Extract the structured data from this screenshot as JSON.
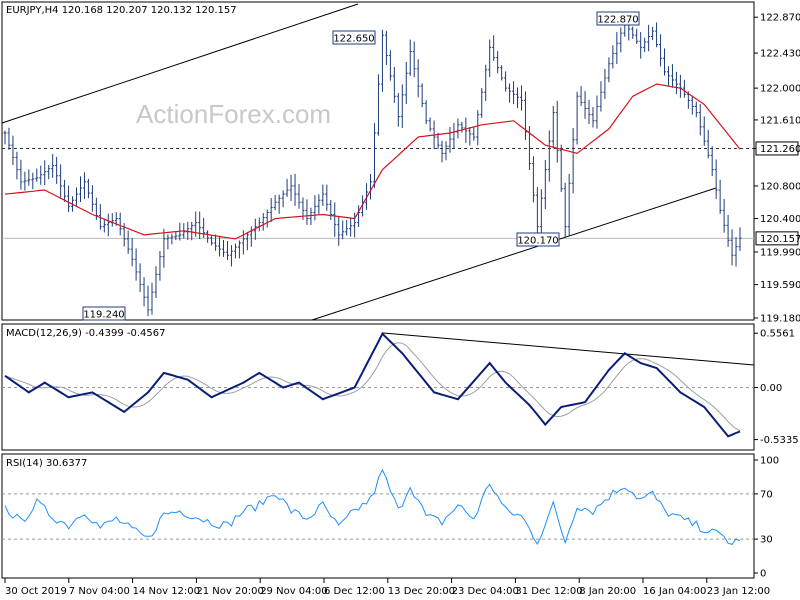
{
  "header": {
    "main": "EURJPY,H4  120.168 120.207 120.132 120.157",
    "macd": "MACD(12,26,9) -0.4399 -0.4567",
    "rsi": "RSI(14) 30.6377"
  },
  "watermark": "ActionForex.com",
  "colors": {
    "price": "#1e3c78",
    "ma": "#d2141e",
    "macd": "#0a1e78",
    "signal": "#9aa0a8",
    "rsi": "#1e90ff",
    "trend": "#000000",
    "frame": "#000000"
  },
  "chart_data": [
    {
      "type": "candlestick",
      "symbol": "EURJPY",
      "timeframe": "H4",
      "ylim": [
        119.18,
        123.02
      ],
      "yticks": [
        "122.870",
        "122.430",
        "122.000",
        "121.610",
        "121.260",
        "120.800",
        "120.400",
        "119.990",
        "119.590",
        "119.180"
      ],
      "current_price": "120.157",
      "hlines": [
        {
          "value": 121.26,
          "style": "dashed",
          "label": "121.260"
        },
        {
          "value": 120.157,
          "style": "solid",
          "label": "120.157"
        }
      ],
      "annotations": [
        {
          "label": "122.650",
          "value": 122.65
        },
        {
          "label": "122.870",
          "value": 122.87
        },
        {
          "label": "120.170",
          "value": 120.17
        },
        {
          "label": "119.240",
          "value": 119.24
        }
      ],
      "anchors": [
        [
          0,
          121.45
        ],
        [
          4,
          120.85
        ],
        [
          8,
          120.9
        ],
        [
          12,
          121.05
        ],
        [
          16,
          120.55
        ],
        [
          20,
          120.85
        ],
        [
          24,
          120.3
        ],
        [
          28,
          120.4
        ],
        [
          32,
          119.9
        ],
        [
          36,
          119.28
        ],
        [
          40,
          120.15
        ],
        [
          44,
          120.2
        ],
        [
          48,
          120.35
        ],
        [
          52,
          120.1
        ],
        [
          56,
          119.95
        ],
        [
          60,
          120.15
        ],
        [
          64,
          120.35
        ],
        [
          68,
          120.6
        ],
        [
          72,
          120.8
        ],
        [
          76,
          120.4
        ],
        [
          80,
          120.7
        ],
        [
          84,
          120.2
        ],
        [
          88,
          120.35
        ],
        [
          92,
          120.85
        ],
        [
          95,
          122.65
        ],
        [
          99,
          121.65
        ],
        [
          102,
          122.45
        ],
        [
          106,
          121.6
        ],
        [
          110,
          121.2
        ],
        [
          114,
          121.55
        ],
        [
          118,
          121.4
        ],
        [
          122,
          122.5
        ],
        [
          126,
          122.0
        ],
        [
          130,
          121.85
        ],
        [
          134,
          120.3
        ],
        [
          138,
          121.7
        ],
        [
          141,
          120.3
        ],
        [
          144,
          121.9
        ],
        [
          148,
          121.6
        ],
        [
          152,
          122.3
        ],
        [
          156,
          122.8
        ],
        [
          160,
          122.5
        ],
        [
          163,
          122.7
        ],
        [
          166,
          122.2
        ],
        [
          170,
          122.0
        ],
        [
          174,
          121.7
        ],
        [
          178,
          121.0
        ],
        [
          180,
          120.5
        ],
        [
          183,
          119.95
        ],
        [
          185,
          120.16
        ]
      ],
      "ma_anchors": [
        [
          0,
          120.7
        ],
        [
          10,
          120.75
        ],
        [
          22,
          120.45
        ],
        [
          35,
          120.2
        ],
        [
          45,
          120.25
        ],
        [
          58,
          120.15
        ],
        [
          68,
          120.4
        ],
        [
          80,
          120.45
        ],
        [
          88,
          120.4
        ],
        [
          95,
          121.0
        ],
        [
          104,
          121.4
        ],
        [
          112,
          121.45
        ],
        [
          120,
          121.55
        ],
        [
          128,
          121.6
        ],
        [
          136,
          121.3
        ],
        [
          144,
          121.2
        ],
        [
          152,
          121.5
        ],
        [
          158,
          121.9
        ],
        [
          164,
          122.05
        ],
        [
          170,
          122.0
        ],
        [
          176,
          121.8
        ],
        [
          185,
          121.25
        ]
      ],
      "x_labels": [
        "30 Oct 2019",
        "7 Nov 04:00",
        "14 Nov 12:00",
        "21 Nov 20:00",
        "29 Nov 04:00",
        "6 Dec 12:00",
        "13 Dec 20:00",
        "23 Dec 04:00",
        "31 Dec 12:00",
        "8 Jan 20:00",
        "16 Jan 04:00",
        "23 Jan 12:00"
      ]
    },
    {
      "type": "line",
      "name": "MACD(12,26,9)",
      "ylim": [
        -0.62,
        0.62
      ],
      "yticks": [
        "0.5561",
        "0.00",
        "-0.5335"
      ],
      "values_label": "-0.4399 -0.4567",
      "anchors": [
        [
          0,
          0.12
        ],
        [
          6,
          -0.05
        ],
        [
          10,
          0.05
        ],
        [
          16,
          -0.1
        ],
        [
          22,
          -0.05
        ],
        [
          30,
          -0.25
        ],
        [
          36,
          -0.05
        ],
        [
          40,
          0.15
        ],
        [
          46,
          0.08
        ],
        [
          52,
          -0.1
        ],
        [
          60,
          0.05
        ],
        [
          64,
          0.15
        ],
        [
          70,
          0.0
        ],
        [
          74,
          0.05
        ],
        [
          80,
          -0.12
        ],
        [
          88,
          0.0
        ],
        [
          95,
          0.55
        ],
        [
          100,
          0.35
        ],
        [
          108,
          -0.05
        ],
        [
          114,
          -0.12
        ],
        [
          122,
          0.25
        ],
        [
          126,
          0.05
        ],
        [
          132,
          -0.18
        ],
        [
          136,
          -0.38
        ],
        [
          140,
          -0.2
        ],
        [
          146,
          -0.15
        ],
        [
          152,
          0.18
        ],
        [
          156,
          0.35
        ],
        [
          160,
          0.25
        ],
        [
          164,
          0.2
        ],
        [
          170,
          -0.05
        ],
        [
          176,
          -0.2
        ],
        [
          182,
          -0.5
        ],
        [
          185,
          -0.45
        ]
      ],
      "signal_lag": 3
    },
    {
      "type": "line",
      "name": "RSI(14)",
      "ylim": [
        0,
        100
      ],
      "yticks": [
        "100",
        "70",
        "30",
        "0"
      ],
      "levels": [
        70,
        30
      ],
      "anchors": [
        [
          0,
          58
        ],
        [
          4,
          45
        ],
        [
          8,
          62
        ],
        [
          12,
          50
        ],
        [
          16,
          42
        ],
        [
          20,
          55
        ],
        [
          24,
          40
        ],
        [
          28,
          48
        ],
        [
          32,
          38
        ],
        [
          36,
          30
        ],
        [
          40,
          52
        ],
        [
          44,
          55
        ],
        [
          48,
          50
        ],
        [
          52,
          45
        ],
        [
          56,
          42
        ],
        [
          60,
          55
        ],
        [
          64,
          60
        ],
        [
          68,
          72
        ],
        [
          72,
          55
        ],
        [
          76,
          48
        ],
        [
          80,
          60
        ],
        [
          84,
          40
        ],
        [
          88,
          55
        ],
        [
          92,
          65
        ],
        [
          95,
          90
        ],
        [
          99,
          55
        ],
        [
          102,
          78
        ],
        [
          106,
          50
        ],
        [
          110,
          45
        ],
        [
          114,
          60
        ],
        [
          118,
          48
        ],
        [
          122,
          80
        ],
        [
          126,
          55
        ],
        [
          130,
          50
        ],
        [
          134,
          28
        ],
        [
          138,
          60
        ],
        [
          141,
          28
        ],
        [
          144,
          60
        ],
        [
          148,
          55
        ],
        [
          152,
          68
        ],
        [
          156,
          78
        ],
        [
          160,
          65
        ],
        [
          163,
          70
        ],
        [
          166,
          55
        ],
        [
          170,
          48
        ],
        [
          174,
          42
        ],
        [
          178,
          36
        ],
        [
          181,
          32
        ],
        [
          183,
          25
        ],
        [
          185,
          31
        ]
      ]
    }
  ]
}
